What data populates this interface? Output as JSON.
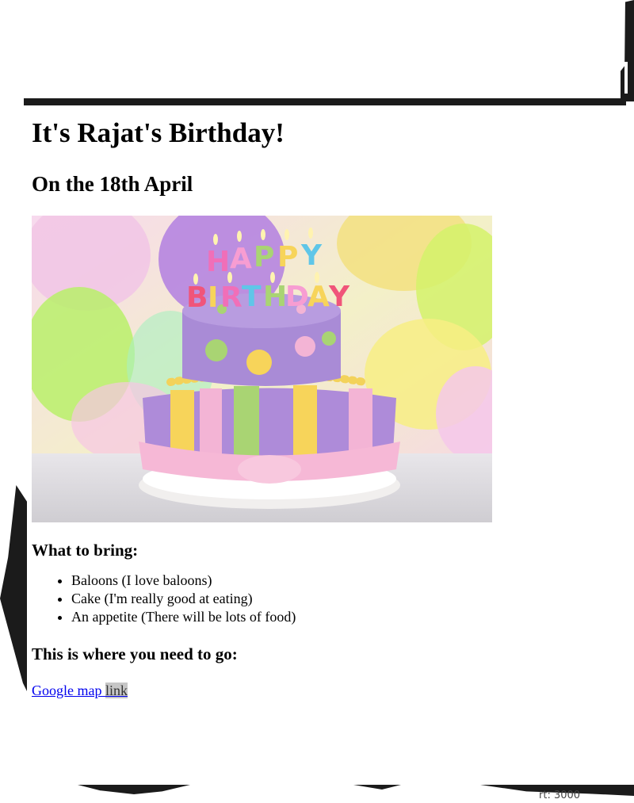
{
  "page": {
    "title": "It's Rajat's Birthday!",
    "date_heading": "On the 18th April",
    "image_alt": "Birthday cake with Happy Birthday candles",
    "bring_heading": "What to bring:",
    "bring_items": [
      "Baloons (I love baloons)",
      "Cake (I'm really good at eating)",
      "An appetite (There will be lots of food)"
    ],
    "where_heading": "This is where you need to go:",
    "map_link_part1": "Google map ",
    "map_link_part2": "link"
  },
  "overlay": {
    "port_text": "rt: 3000"
  },
  "colors": {
    "link": "#0000ee",
    "selection": "#c6c6c6",
    "frame": "#1b1b1b"
  },
  "icons": {
    "cake-image": "happy-birthday-cake"
  }
}
